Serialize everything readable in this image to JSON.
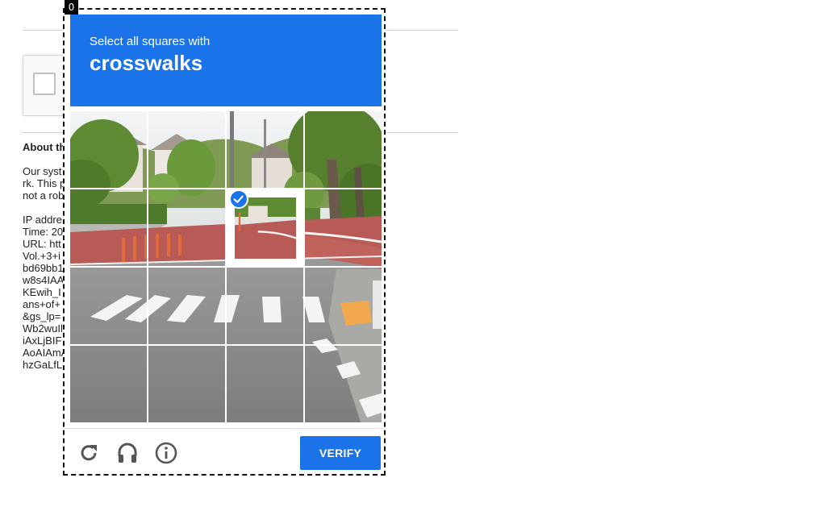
{
  "frame": {
    "index_label": "0"
  },
  "page": {
    "about_heading": "About th",
    "about_lines": [
      "Our syst",
      "rk. This p",
      "not a rob",
      "",
      "IP addre",
      "Time: 20",
      "URL: htt",
      "Vol.+3+i",
      "bd69bb1",
      "w8s4IAA",
      "KEwih_I",
      "ans+of+",
      "&gs_lp=",
      "Wb2wuIl",
      "iAxLjBIF",
      "AoAIAmA",
      "hzGaLfL"
    ]
  },
  "challenge": {
    "prompt_line1": "Select all squares with",
    "prompt_target": "crosswalks",
    "grid": {
      "rows": 4,
      "cols": 4,
      "selected": [
        [
          1,
          2
        ]
      ]
    },
    "verify_label": "VERIFY"
  },
  "icons": {
    "reload": "reload-icon",
    "audio": "headphones-icon",
    "info": "info-icon",
    "check": "checkmark-icon"
  },
  "colors": {
    "accent": "#1a73e8",
    "road_red": "#b85a55",
    "asphalt": "#8a8a8a",
    "sky": "#eef1f2",
    "foliage": "#6a8f3c",
    "marking": "#f4f4f4",
    "icon_gray": "#555555"
  }
}
